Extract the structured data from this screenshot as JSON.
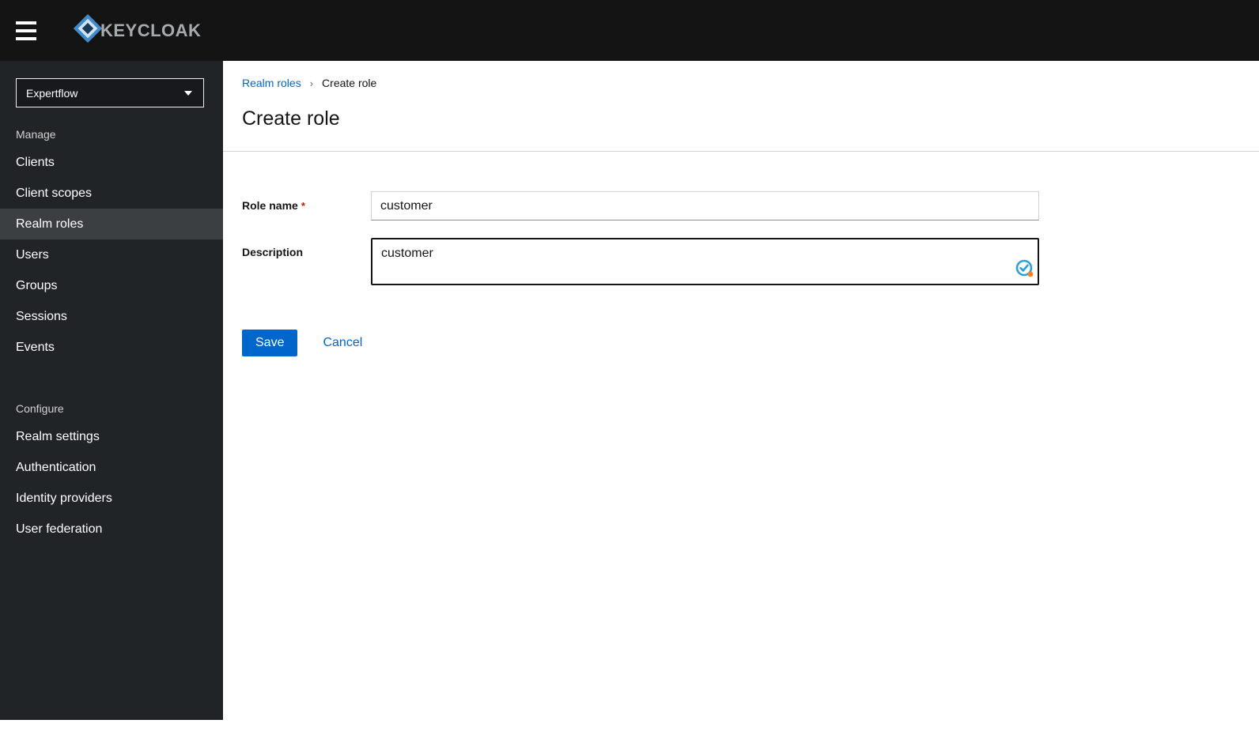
{
  "topbar": {
    "brand": "KEYCLOAK"
  },
  "sidebar": {
    "realm_selector": {
      "value": "Expertflow"
    },
    "selected": "Realm roles",
    "sections": [
      {
        "label": "Manage",
        "items": [
          "Clients",
          "Client scopes",
          "Realm roles",
          "Users",
          "Groups",
          "Sessions",
          "Events"
        ]
      },
      {
        "label": "Configure",
        "items": [
          "Realm settings",
          "Authentication",
          "Identity providers",
          "User federation"
        ]
      }
    ]
  },
  "breadcrumb": {
    "items": [
      "Realm roles",
      "Create role"
    ]
  },
  "page": {
    "title": "Create role"
  },
  "form": {
    "role_name": {
      "label": "Role name",
      "required_marker": "*",
      "value": "customer"
    },
    "description": {
      "label": "Description",
      "value": "customer"
    },
    "save_label": "Save",
    "cancel_label": "Cancel"
  },
  "icons": {
    "hamburger": "menu-icon",
    "realm_caret": "chevron-down-icon",
    "breadcrumb_sep": "›",
    "textarea_badge": "check-badge-icon"
  },
  "colors": {
    "accent": "#0066cc",
    "topbar_bg": "#141414",
    "sidebar_bg": "#212427",
    "sidebar_selected_bg": "#3c3f42",
    "required_red": "#c9190b",
    "badge_blue": "#2b9fdd",
    "badge_orange": "#f48024"
  }
}
